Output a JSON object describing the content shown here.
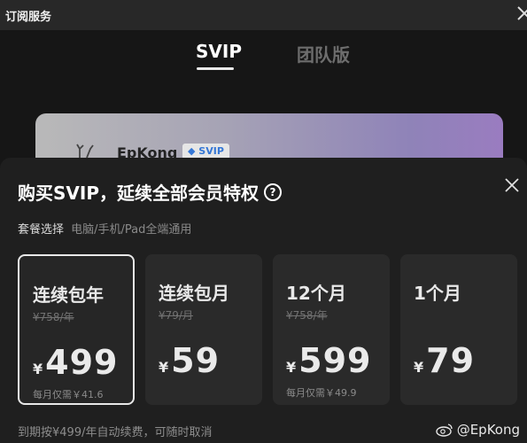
{
  "window": {
    "title": "订阅服务"
  },
  "tabs": [
    {
      "label": "SVIP",
      "active": true
    },
    {
      "label": "团队版",
      "active": false
    }
  ],
  "member_card": {
    "username": "EpKong",
    "badge": "SVIP"
  },
  "sheet": {
    "heading": "购买SVIP，延续全部会员特权",
    "help_icon_text": "?",
    "package_label": "套餐选择",
    "package_desc": "电脑/手机/Pad全端通用",
    "plans": [
      {
        "name": "连续包年",
        "original": "¥758/年",
        "currency": "¥",
        "price": "499",
        "monthly": "每月仅需￥41.6",
        "selected": true
      },
      {
        "name": "连续包月",
        "original": "¥79/月",
        "currency": "¥",
        "price": "59",
        "monthly": "",
        "selected": false
      },
      {
        "name": "12个月",
        "original": "¥758/年",
        "currency": "¥",
        "price": "599",
        "monthly": "每月仅需￥49.9",
        "selected": false
      },
      {
        "name": "1个月",
        "original": "",
        "currency": "¥",
        "price": "79",
        "monthly": "",
        "selected": false
      }
    ],
    "renewal_note": "到期按¥499/年自动续费，可随时取消"
  },
  "watermark": {
    "text": "@EpKong"
  },
  "colors": {
    "background": "#161616",
    "sheet": "#1f1f1f",
    "card_bg": "#2a2a2a",
    "selected_border": "#e8e8e8",
    "muted_text": "#8a8a8a"
  }
}
